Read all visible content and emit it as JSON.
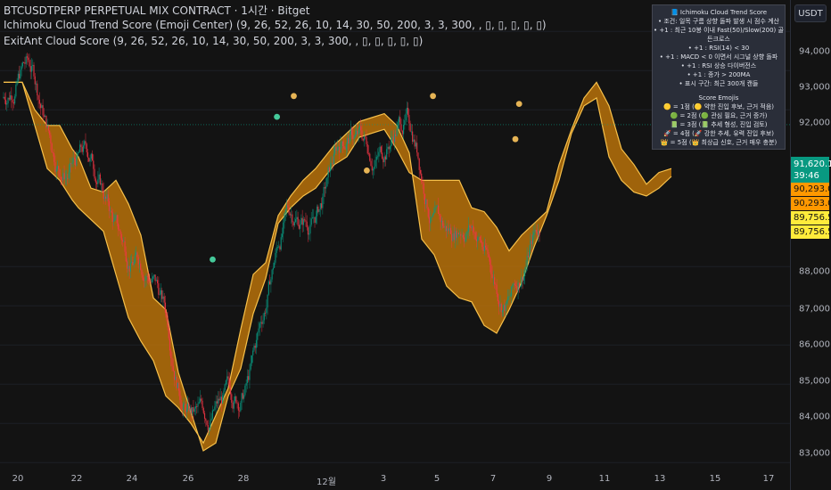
{
  "header": {
    "line1": "BTCUSDTPERP PERPETUAL MIX CONTRACT · 1시간 · Bitget",
    "line2": "Ichimoku Cloud Trend Score (Emoji Center) (9, 26, 52, 26, 10, 14, 30, 50, 200, 3, 3, 300,  , ▯, ▯, ▯, ▯, ▯)",
    "line3": "ExitAnt Cloud Score (9, 26, 52, 26, 10, 14, 30, 50, 200, 3, 3, 300,  , ▯, ▯, ▯, ▯, ▯)"
  },
  "axis": {
    "currency": "USDT",
    "price_labels": [
      "94,000.0",
      "93,000.0",
      "92,000.0",
      "88,000.0",
      "87,000.0",
      "86,000.0",
      "85,000.0",
      "84,000.0",
      "83,000.0"
    ],
    "x_labels": [
      "20",
      "22",
      "24",
      "26",
      "28",
      "12월",
      "3",
      "5",
      "7",
      "9",
      "11",
      "13",
      "15",
      "17"
    ]
  },
  "tags": {
    "current_price": "91,620.1",
    "countdown": "39:46",
    "orange_1": "90,293.0",
    "orange_2": "90,293.0",
    "yellow_1": "89,756.5",
    "yellow_2": "89,756.5"
  },
  "legend": {
    "title": "📘 Ichimoku Cloud Trend Score",
    "lines": [
      "• 조건: 일목 구름 상향 돌파 발생 시 점수 계산",
      "• +1 : 최근 10봉 이내 Fast(50)/Slow(200) 골든크로스",
      "• +1 : RSI(14) < 30",
      "• +1 : MACD < 0 이면서 시그널 상향 돌파",
      "• +1 : RSI 상승 다이버전스",
      "• +1 : 종가 > 200MA",
      "• 표시 구간: 최근 300개 캔들"
    ],
    "emoji_title": "Score Emojis",
    "emoji_lines": [
      "🟡 = 1점 (🟡 약한 진입 후보, 근거 적음)",
      "🟢 = 2점 (🟢 관심 필요, 근거 증가)",
      "📗 = 3점 (📗 추세 형성, 진입 검토)",
      "🚀 = 4점 (🚀 강한 추세, 유력 진입 후보)",
      "👑 = 5점 (👑 최상급 신호, 근거 매우 충분)"
    ]
  },
  "colors": {
    "background": "#131313",
    "cloud_fill": "#b8720b",
    "cloud_line": "#f7c04a",
    "candle_up": "#089981",
    "candle_down": "#f23645",
    "signal_yellow": "#e6b455",
    "signal_green": "#45c99a"
  },
  "chart_data": {
    "type": "line",
    "title": "BTCUSDTPERP PERPETUAL MIX CONTRACT · 1시간 · Bitget",
    "ylim": [
      82800,
      94800
    ],
    "x_tick_labels": [
      "20",
      "22",
      "24",
      "26",
      "28",
      "12월",
      "3",
      "5",
      "7",
      "9",
      "11",
      "13",
      "15",
      "17"
    ],
    "y_ticks": [
      83000,
      84000,
      85000,
      86000,
      87000,
      88000,
      92000,
      93000,
      94000
    ],
    "series": [
      {
        "name": "Ichimoku Cloud Trend Score (Emoji Center)",
        "x": [
          0,
          1,
          2,
          3,
          4,
          5,
          6,
          7,
          8,
          9,
          10,
          11,
          12,
          13,
          14,
          15,
          16,
          17,
          18,
          19,
          20,
          21,
          22,
          23,
          24,
          25,
          26,
          27,
          28,
          29,
          30,
          31,
          32,
          33,
          34,
          35,
          36,
          37,
          38,
          39,
          40,
          41,
          42,
          43,
          44,
          45,
          46,
          47,
          48,
          49,
          50,
          51,
          52,
          53,
          54,
          55,
          56,
          57,
          58,
          59,
          60,
          61,
          62,
          63,
          64,
          65,
          66,
          67,
          68,
          69,
          70,
          71,
          72
        ],
        "upper": [
          92700,
          92700,
          92700,
          92700,
          92700,
          92700,
          92700,
          92700,
          92700,
          92700,
          92700,
          92700,
          92700,
          92700,
          92700,
          92700,
          92700,
          92700,
          92700,
          92700,
          92700,
          92700,
          92700,
          92700,
          92700,
          92700,
          92700,
          92700,
          92700,
          92700,
          92700,
          92700,
          92700,
          92700,
          92700,
          92700,
          92700,
          92700,
          92700,
          92700,
          92700,
          92700,
          92700,
          92700,
          92700,
          92700,
          92700,
          92700,
          92700,
          92700,
          92700,
          92700,
          92700,
          92700,
          92700,
          92700,
          92700,
          92700,
          92700,
          92700,
          92700,
          92700,
          92700,
          92700,
          92700,
          92700,
          92700,
          92700,
          92700,
          92700,
          92700,
          92700,
          92700
        ],
        "lower": [
          92700,
          92700,
          92700,
          92700,
          92700,
          92700,
          92700,
          92700,
          92700,
          92700,
          92700,
          92700,
          92700,
          92700,
          92700,
          92700,
          92700,
          92700,
          92700,
          92700,
          92700,
          92700,
          92700,
          92700,
          92700,
          92700,
          92700,
          92700,
          92700,
          92700,
          92700,
          92700,
          92700,
          92700,
          92700,
          92700,
          92700,
          92700,
          92700,
          92700,
          92700,
          92700,
          92700,
          92700,
          92700,
          92700,
          92700,
          92700,
          92700,
          92700,
          92700,
          92700,
          92700,
          92700,
          92700,
          92700,
          92700,
          92700,
          92700,
          92700,
          92700,
          92700,
          92700,
          92700,
          92700,
          92700,
          92700,
          92700,
          92700,
          92700,
          92700,
          92700,
          92700
        ]
      }
    ],
    "cloud": {
      "upper": [
        [
          0,
          92700
        ],
        [
          3,
          92700
        ],
        [
          5,
          92000
        ],
        [
          7,
          91600
        ],
        [
          9,
          91600
        ],
        [
          11,
          91000
        ],
        [
          12,
          90800
        ],
        [
          14,
          90000
        ],
        [
          16,
          89900
        ],
        [
          18,
          90200
        ],
        [
          20,
          89600
        ],
        [
          22,
          88800
        ],
        [
          24,
          87200
        ],
        [
          26,
          86900
        ],
        [
          28,
          85300
        ],
        [
          30,
          84300
        ],
        [
          32,
          83300
        ],
        [
          34,
          83500
        ],
        [
          36,
          84700
        ],
        [
          38,
          85400
        ],
        [
          40,
          86800
        ],
        [
          42,
          87700
        ],
        [
          44,
          89100
        ],
        [
          46,
          89500
        ],
        [
          48,
          89800
        ],
        [
          50,
          90000
        ],
        [
          53,
          90600
        ],
        [
          55,
          90800
        ],
        [
          57,
          91300
        ],
        [
          59,
          91400
        ],
        [
          61,
          91500
        ],
        [
          63,
          91000
        ],
        [
          65,
          90400
        ],
        [
          67,
          90200
        ],
        [
          69,
          90200
        ],
        [
          71,
          90200
        ],
        [
          73,
          90200
        ],
        [
          75,
          89500
        ],
        [
          77,
          89400
        ],
        [
          79,
          89000
        ],
        [
          81,
          88400
        ],
        [
          83,
          88800
        ],
        [
          85,
          89100
        ],
        [
          87,
          89400
        ],
        [
          89,
          90600
        ],
        [
          91,
          91500
        ],
        [
          93,
          92300
        ],
        [
          95,
          92700
        ],
        [
          97,
          92100
        ],
        [
          99,
          91000
        ],
        [
          101,
          90600
        ],
        [
          103,
          90100
        ],
        [
          105,
          90400
        ],
        [
          107,
          90500
        ]
      ],
      "lower": [
        [
          0,
          92700
        ],
        [
          3,
          92700
        ],
        [
          5,
          91600
        ],
        [
          7,
          90500
        ],
        [
          9,
          90200
        ],
        [
          11,
          89700
        ],
        [
          12,
          89500
        ],
        [
          14,
          89200
        ],
        [
          16,
          88900
        ],
        [
          18,
          87800
        ],
        [
          20,
          86700
        ],
        [
          22,
          86100
        ],
        [
          24,
          85600
        ],
        [
          26,
          84700
        ],
        [
          28,
          84400
        ],
        [
          30,
          84000
        ],
        [
          32,
          83500
        ],
        [
          34,
          84200
        ],
        [
          36,
          84900
        ],
        [
          38,
          86400
        ],
        [
          40,
          87800
        ],
        [
          42,
          88100
        ],
        [
          44,
          89300
        ],
        [
          46,
          89800
        ],
        [
          48,
          90200
        ],
        [
          50,
          90500
        ],
        [
          53,
          91100
        ],
        [
          55,
          91400
        ],
        [
          57,
          91700
        ],
        [
          59,
          91800
        ],
        [
          61,
          91900
        ],
        [
          63,
          91600
        ],
        [
          65,
          90900
        ],
        [
          67,
          88700
        ],
        [
          69,
          88300
        ],
        [
          71,
          87500
        ],
        [
          73,
          87200
        ],
        [
          75,
          87100
        ],
        [
          77,
          86500
        ],
        [
          79,
          86300
        ],
        [
          81,
          86900
        ],
        [
          83,
          87600
        ],
        [
          85,
          88500
        ],
        [
          87,
          89300
        ],
        [
          89,
          90200
        ],
        [
          91,
          91400
        ],
        [
          93,
          92100
        ],
        [
          95,
          92300
        ],
        [
          97,
          90800
        ],
        [
          99,
          90200
        ],
        [
          101,
          89900
        ],
        [
          103,
          89800
        ],
        [
          105,
          90000
        ],
        [
          107,
          90300
        ]
      ]
    },
    "signals": [
      {
        "score": 2,
        "x": 33.5,
        "price": 88180
      },
      {
        "score": 2,
        "x": 43.8,
        "price": 91820
      },
      {
        "score": 1,
        "x": 46.5,
        "price": 92350
      },
      {
        "score": 1,
        "x": 58.2,
        "price": 90450
      },
      {
        "score": 1,
        "x": 68.8,
        "price": 92350
      },
      {
        "score": 1,
        "x": 82.6,
        "price": 92150
      },
      {
        "score": 1,
        "x": 82.0,
        "price": 91250
      }
    ]
  }
}
